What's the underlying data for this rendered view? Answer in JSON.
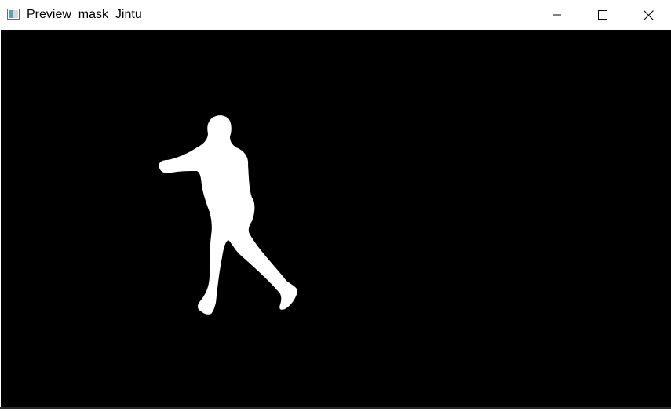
{
  "window": {
    "title": "Preview_mask_Jintu",
    "app_icon": "opencv-window-icon"
  },
  "controls": {
    "minimize_icon": "minimize-icon",
    "maximize_icon": "maximize-icon",
    "close_icon": "close-icon"
  },
  "canvas": {
    "background_color": "#000000",
    "mask_color": "#ffffff",
    "content": "person-silhouette-mask"
  }
}
